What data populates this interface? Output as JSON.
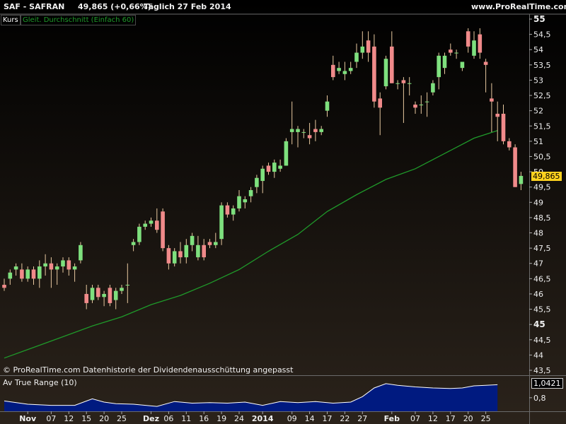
{
  "header": {
    "symbol": "SAF - SAFRAN",
    "quote": "49,865 (+0,66%)",
    "period": "Täglich  27 Feb 2014",
    "site": "www.ProRealTime.com"
  },
  "price_panel": {
    "label": "Kurs",
    "indicator_label": "Gleit. Durchschnitt (Einfach 60)",
    "last_value_label": "49,865",
    "footer": "© ProRealTime.com  Datenhistorie der Dividendenausschüttung angepasst"
  },
  "atr_panel": {
    "label": "Av True Range (10)",
    "last_value_label": "1,0421"
  },
  "colors": {
    "background_top": "#000000",
    "background_bottom": "#2b231b",
    "up_candle": "#7ee07e",
    "down_candle": "#f08a8a",
    "wick": "#e8c9a0",
    "moving_average": "#1f9a2a",
    "atr_fill": "#001a80",
    "atr_line": "#ffffff",
    "last_value_bg": "#ffd21f"
  },
  "chart_data": [
    {
      "type": "candlestick",
      "title": "SAF - SAFRAN",
      "ylim": [
        43.5,
        55
      ],
      "yticks": [
        {
          "value": 55,
          "label": "55"
        },
        {
          "value": 54.5,
          "label": "54,5"
        },
        {
          "value": 54,
          "label": "54"
        },
        {
          "value": 53.5,
          "label": "53,5"
        },
        {
          "value": 53,
          "label": "53"
        },
        {
          "value": 52.5,
          "label": "52,5"
        },
        {
          "value": 52,
          "label": "52"
        },
        {
          "value": 51.5,
          "label": "51,5"
        },
        {
          "value": 51,
          "label": "51"
        },
        {
          "value": 50.5,
          "label": "50,5"
        },
        {
          "value": 50,
          "label": "50"
        },
        {
          "value": 49.5,
          "label": "49,5"
        },
        {
          "value": 49,
          "label": "49"
        },
        {
          "value": 48.5,
          "label": "48,5"
        },
        {
          "value": 48,
          "label": "48"
        },
        {
          "value": 47.5,
          "label": "47,5"
        },
        {
          "value": 47,
          "label": "47"
        },
        {
          "value": 46.5,
          "label": "46,5"
        },
        {
          "value": 46,
          "label": "46"
        },
        {
          "value": 45.5,
          "label": "45,5"
        },
        {
          "value": 45,
          "label": "45"
        },
        {
          "value": 44.5,
          "label": "44,5"
        },
        {
          "value": 44,
          "label": "44"
        },
        {
          "value": 43.5,
          "label": "43,5"
        }
      ],
      "xticks": [
        {
          "index": 4,
          "label": "Nov"
        },
        {
          "index": 8,
          "label": "07"
        },
        {
          "index": 11,
          "label": "12"
        },
        {
          "index": 14,
          "label": "15"
        },
        {
          "index": 17,
          "label": "20"
        },
        {
          "index": 20,
          "label": "25"
        },
        {
          "index": 25,
          "label": "Dez"
        },
        {
          "index": 28,
          "label": "06"
        },
        {
          "index": 31,
          "label": "11"
        },
        {
          "index": 34,
          "label": "16"
        },
        {
          "index": 37,
          "label": "19"
        },
        {
          "index": 40,
          "label": "24"
        },
        {
          "index": 44,
          "label": "2014"
        },
        {
          "index": 49,
          "label": "09"
        },
        {
          "index": 52,
          "label": "14"
        },
        {
          "index": 55,
          "label": "17"
        },
        {
          "index": 58,
          "label": "22"
        },
        {
          "index": 61,
          "label": "27"
        },
        {
          "index": 66,
          "label": "Feb"
        },
        {
          "index": 70,
          "label": "07"
        },
        {
          "index": 73,
          "label": "12"
        },
        {
          "index": 76,
          "label": "17"
        },
        {
          "index": 79,
          "label": "20"
        },
        {
          "index": 82,
          "label": "25"
        }
      ],
      "series": [
        {
          "name": "Kurs",
          "ohlc": [
            [
              46.3,
              46.5,
              46.1,
              46.2
            ],
            [
              46.5,
              46.8,
              46.3,
              46.7
            ],
            [
              46.8,
              47.0,
              46.6,
              46.9
            ],
            [
              46.8,
              47.0,
              46.4,
              46.5
            ],
            [
              46.5,
              46.9,
              46.4,
              46.8
            ],
            [
              46.8,
              46.9,
              46.3,
              46.5
            ],
            [
              46.5,
              47.1,
              46.2,
              46.9
            ],
            [
              46.9,
              47.3,
              46.6,
              47.0
            ],
            [
              47.0,
              47.2,
              46.2,
              46.8
            ],
            [
              46.8,
              47.0,
              46.3,
              46.9
            ],
            [
              46.9,
              47.2,
              46.7,
              47.1
            ],
            [
              47.1,
              47.2,
              46.6,
              46.8
            ],
            [
              46.8,
              47.0,
              46.4,
              46.9
            ],
            [
              47.1,
              47.7,
              47.0,
              47.6
            ],
            [
              46.0,
              46.3,
              45.5,
              45.7
            ],
            [
              45.8,
              46.3,
              45.7,
              46.2
            ],
            [
              46.2,
              46.3,
              45.8,
              45.9
            ],
            [
              45.9,
              46.1,
              45.6,
              46.0
            ],
            [
              46.2,
              46.3,
              45.6,
              45.7
            ],
            [
              45.8,
              46.2,
              45.5,
              46.1
            ],
            [
              46.1,
              46.3,
              46.0,
              46.2
            ],
            [
              46.3,
              47.0,
              45.7,
              46.3
            ],
            [
              47.6,
              47.8,
              47.4,
              47.7
            ],
            [
              47.7,
              48.3,
              47.6,
              48.2
            ],
            [
              48.2,
              48.4,
              48.1,
              48.3
            ],
            [
              48.3,
              48.5,
              48.2,
              48.4
            ],
            [
              48.4,
              48.8,
              48.0,
              48.1
            ],
            [
              48.7,
              48.8,
              47.4,
              47.5
            ],
            [
              47.5,
              47.6,
              46.8,
              47.0
            ],
            [
              47.0,
              47.5,
              46.9,
              47.4
            ],
            [
              47.4,
              47.7,
              47.0,
              47.2
            ],
            [
              47.2,
              47.8,
              47.0,
              47.6
            ],
            [
              47.6,
              48.0,
              47.4,
              47.9
            ],
            [
              47.2,
              47.9,
              47.1,
              47.6
            ],
            [
              47.6,
              47.8,
              47.1,
              47.2
            ],
            [
              47.7,
              47.8,
              47.5,
              47.6
            ],
            [
              47.6,
              48.0,
              47.5,
              47.7
            ],
            [
              47.8,
              49.0,
              47.6,
              48.9
            ],
            [
              48.9,
              49.0,
              48.5,
              48.6
            ],
            [
              48.6,
              48.9,
              48.4,
              48.8
            ],
            [
              48.8,
              49.4,
              48.7,
              49.2
            ],
            [
              49.0,
              49.2,
              48.8,
              49.1
            ],
            [
              49.2,
              49.5,
              49.0,
              49.4
            ],
            [
              49.5,
              49.9,
              49.3,
              49.8
            ],
            [
              49.7,
              50.2,
              49.3,
              50.1
            ],
            [
              50.2,
              50.3,
              49.9,
              50.0
            ],
            [
              50.0,
              50.4,
              49.8,
              50.3
            ],
            [
              50.1,
              50.4,
              50.0,
              50.2
            ],
            [
              50.2,
              51.1,
              50.2,
              51.0
            ],
            [
              51.3,
              52.3,
              50.9,
              51.4
            ],
            [
              51.3,
              51.5,
              50.8,
              51.4
            ],
            [
              51.3,
              51.4,
              51.1,
              51.3
            ],
            [
              51.2,
              51.6,
              50.9,
              51.1
            ],
            [
              51.4,
              51.7,
              51.0,
              51.3
            ],
            [
              51.3,
              51.5,
              51.2,
              51.4
            ],
            [
              52.0,
              52.5,
              51.8,
              52.3
            ],
            [
              53.5,
              53.8,
              53.0,
              53.1
            ],
            [
              53.3,
              53.6,
              53.2,
              53.4
            ],
            [
              53.2,
              53.6,
              53.0,
              53.3
            ],
            [
              53.3,
              53.6,
              53.2,
              53.4
            ],
            [
              53.6,
              54.2,
              53.4,
              53.9
            ],
            [
              53.9,
              54.6,
              53.7,
              54.1
            ],
            [
              54.3,
              54.6,
              53.6,
              53.9
            ],
            [
              54.1,
              54.5,
              52.1,
              52.3
            ],
            [
              52.4,
              52.6,
              51.2,
              52.1
            ],
            [
              52.8,
              53.8,
              52.7,
              53.7
            ],
            [
              54.1,
              54.6,
              52.9,
              52.9
            ],
            [
              52.9,
              53.0,
              52.7,
              52.9
            ],
            [
              53.0,
              53.1,
              51.6,
              52.9
            ],
            [
              52.9,
              53.1,
              52.5,
              52.9
            ],
            [
              52.2,
              52.3,
              51.9,
              52.1
            ],
            [
              52.2,
              52.5,
              51.9,
              52.2
            ],
            [
              52.3,
              52.6,
              51.8,
              52.3
            ],
            [
              52.6,
              53.0,
              52.5,
              52.9
            ],
            [
              53.1,
              53.9,
              52.7,
              53.8
            ],
            [
              53.4,
              53.9,
              53.2,
              53.8
            ],
            [
              54.0,
              54.2,
              53.8,
              53.9
            ],
            [
              53.9,
              54.0,
              53.7,
              53.9
            ],
            [
              53.4,
              53.6,
              53.3,
              53.6
            ],
            [
              54.6,
              54.7,
              53.9,
              54.1
            ],
            [
              53.8,
              54.6,
              53.7,
              54.3
            ],
            [
              54.5,
              54.7,
              53.7,
              53.9
            ],
            [
              53.6,
              53.7,
              52.6,
              53.5
            ],
            [
              52.4,
              52.9,
              51.3,
              52.3
            ],
            [
              51.9,
              52.3,
              51.0,
              51.8
            ],
            [
              51.9,
              52.2,
              50.9,
              51.0
            ],
            [
              51.0,
              51.1,
              50.7,
              50.8
            ],
            [
              50.8,
              50.9,
              49.5,
              49.5
            ],
            [
              49.6,
              50.0,
              49.4,
              49.865
            ]
          ]
        },
        {
          "name": "Gleit. Durchschnitt (Einfach 60)",
          "points": [
            [
              0,
              43.9
            ],
            [
              5,
              44.25
            ],
            [
              10,
              44.6
            ],
            [
              15,
              44.95
            ],
            [
              20,
              45.25
            ],
            [
              25,
              45.65
            ],
            [
              30,
              45.95
            ],
            [
              35,
              46.35
            ],
            [
              40,
              46.8
            ],
            [
              45,
              47.4
            ],
            [
              50,
              47.95
            ],
            [
              55,
              48.7
            ],
            [
              60,
              49.25
            ],
            [
              65,
              49.75
            ],
            [
              70,
              50.1
            ],
            [
              75,
              50.6
            ],
            [
              80,
              51.1
            ],
            [
              84,
              51.35
            ]
          ]
        }
      ]
    },
    {
      "type": "area",
      "title": "Av True Range (10)",
      "ylim": [
        0.55,
        1.15
      ],
      "yticks": [
        {
          "value": 0.8,
          "label": "0,8"
        }
      ],
      "series": [
        {
          "name": "Av True Range (10)",
          "x": [
            0,
            4,
            8,
            12,
            15,
            17,
            19,
            22,
            26,
            29,
            32,
            35,
            38,
            41,
            44,
            47,
            50,
            53,
            56,
            59,
            61,
            63,
            65,
            67,
            70,
            73,
            76,
            78,
            80,
            82,
            84
          ],
          "values": [
            0.74,
            0.68,
            0.66,
            0.66,
            0.78,
            0.72,
            0.69,
            0.68,
            0.64,
            0.73,
            0.7,
            0.71,
            0.7,
            0.72,
            0.66,
            0.73,
            0.71,
            0.73,
            0.7,
            0.72,
            0.82,
            0.98,
            1.06,
            1.03,
            1.0,
            0.98,
            0.97,
            0.98,
            1.02,
            1.03,
            1.04
          ]
        }
      ]
    }
  ]
}
